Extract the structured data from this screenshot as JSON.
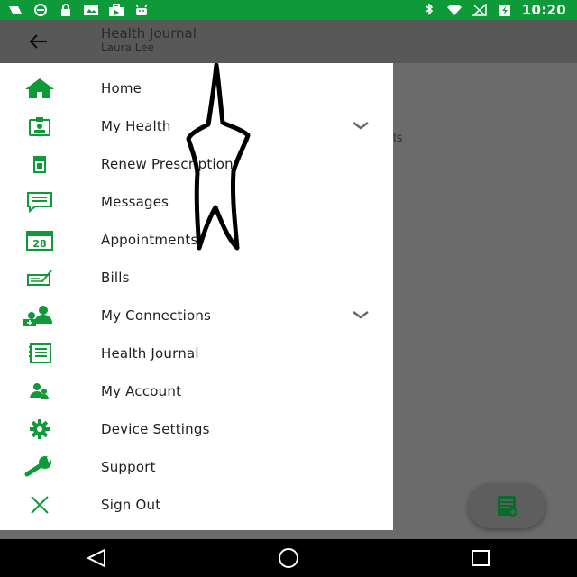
{
  "status_bar": {
    "time": "10:20",
    "icons": [
      "fax-icon",
      "dnd-icon",
      "lock-icon",
      "photo-icon",
      "briefcase-icon",
      "android-icon",
      "bluetooth-icon",
      "wifi-icon",
      "no-signal-icon",
      "battery-charging-icon"
    ]
  },
  "app_bar": {
    "title": "Health Journal",
    "subtitle": "Laura Lee"
  },
  "behind": {
    "partial_text": "ls"
  },
  "drawer": {
    "items": [
      {
        "label": "Home",
        "icon": "home-icon"
      },
      {
        "label": "My Health",
        "icon": "health-id-icon",
        "expandable": true
      },
      {
        "label": "Renew Prescription",
        "icon": "prescription-icon"
      },
      {
        "label": "Messages",
        "icon": "message-icon"
      },
      {
        "label": "Appointments",
        "icon": "calendar-icon",
        "badge": "28"
      },
      {
        "label": "Bills",
        "icon": "bill-icon"
      },
      {
        "label": "My Connections",
        "icon": "connections-icon",
        "expandable": true
      },
      {
        "label": "Health Journal",
        "icon": "journal-icon"
      },
      {
        "label": "My Account",
        "icon": "account-icon"
      },
      {
        "label": "Device Settings",
        "icon": "gear-icon"
      },
      {
        "label": "Support",
        "icon": "wrench-icon"
      },
      {
        "label": "Sign Out",
        "icon": "close-icon"
      }
    ]
  },
  "colors": {
    "accent": "#0f9a3a",
    "drawer_bg": "#ffffff",
    "scrim": "#6b6b6b"
  }
}
